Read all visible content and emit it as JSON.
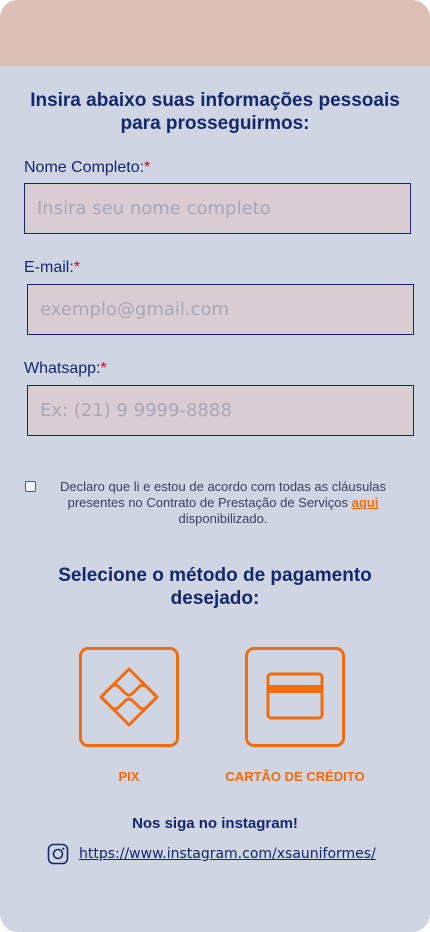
{
  "header": {
    "title": "Insira abaixo suas informações pessoais para prosseguirmos:"
  },
  "form": {
    "name_label": "Nome Completo:",
    "name_placeholder": "Insira seu nome completo",
    "email_label": "E-mail:",
    "email_placeholder": "exemplo@gmail.com",
    "whatsapp_label": "Whatsapp:",
    "whatsapp_placeholder": "Ex: (21) 9 9999-8888",
    "required_mark": "*"
  },
  "consent": {
    "checked": false,
    "text": "Declaro que li e estou de acordo com todas as cláusulas presentes no Contrato de Prestação de Serviços",
    "link_text": "aqui",
    "suffix": "disponibilizado."
  },
  "payment": {
    "title": "Selecione o método de pagamento desejado:",
    "options": [
      {
        "label": "PIX",
        "icon": "pix-icon"
      },
      {
        "label": "CARTÃO DE CRÉDITO",
        "icon": "credit-card-icon"
      }
    ]
  },
  "social": {
    "title": "Nos siga no instagram!",
    "icon": "instagram-icon",
    "url": "https://www.instagram.com/xsauniformes/"
  },
  "colors": {
    "background": "#cfd5e2",
    "top_band": "#dcc0b6",
    "primary_text": "#14286b",
    "accent": "#f26b0d",
    "input_bg": "#d9cdd3",
    "required": "#b3121c"
  }
}
